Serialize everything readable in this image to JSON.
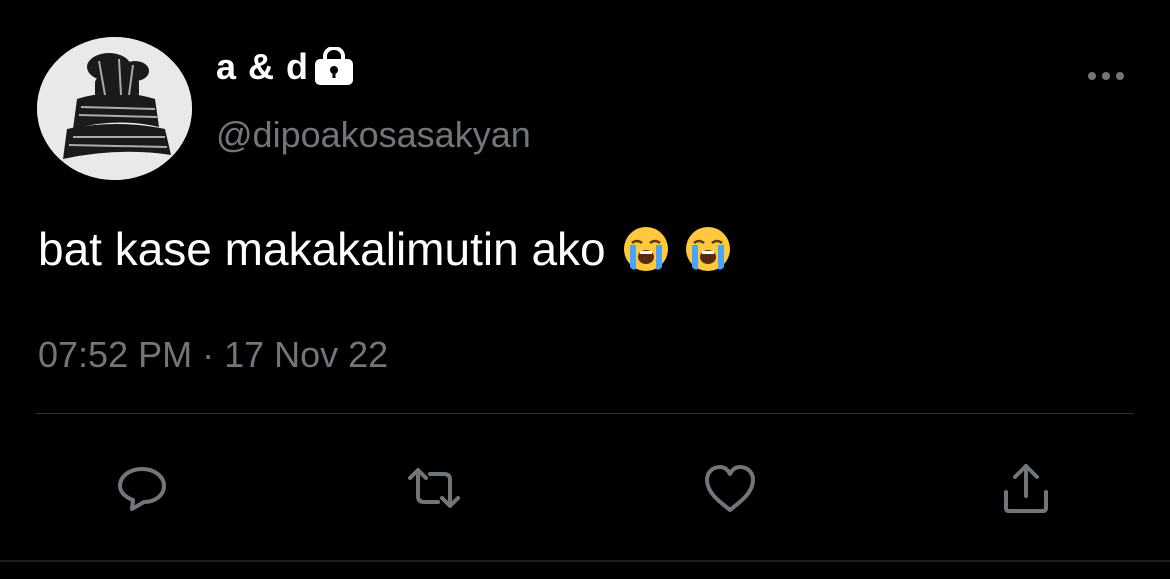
{
  "tweet": {
    "display_name": "a & d",
    "handle": "@dipoakosasakyan",
    "protected": true,
    "text": "bat kase makakalimutin ako",
    "emojis": [
      "loudly-crying-face",
      "loudly-crying-face"
    ],
    "time": "07:52 PM",
    "separator": " · ",
    "date": "17 Nov 22"
  },
  "icons": {
    "lock": "lock-icon",
    "more": "more-horizontal-icon",
    "reply": "reply-icon",
    "retweet": "retweet-icon",
    "like": "heart-icon",
    "share": "share-icon"
  },
  "colors": {
    "background": "#000000",
    "primary_text": "#ffffff",
    "secondary_text": "#71767b",
    "divider": "#2f3336"
  }
}
